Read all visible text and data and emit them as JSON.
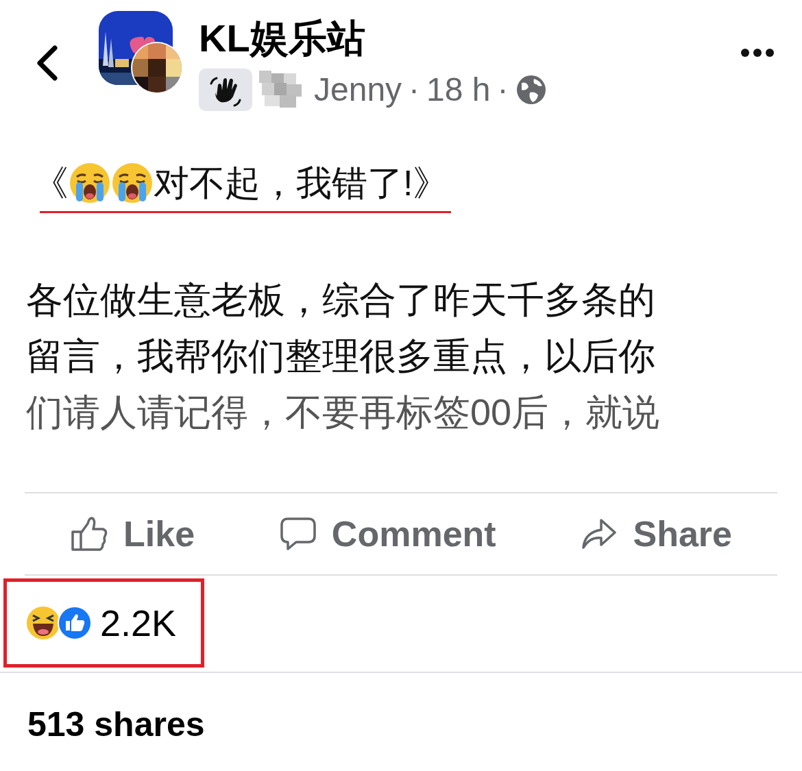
{
  "header": {
    "page_name": "KL娱乐站",
    "author": "Jenny",
    "separator_1": "·",
    "time": "18 h",
    "separator_2": "·"
  },
  "post": {
    "title_open": "《",
    "title_emojis": [
      {
        "kind": "crying"
      },
      {
        "kind": "crying"
      }
    ],
    "title_text": "对不起，我错了!》",
    "body_lines": [
      "各位做生意老板，综合了昨天千多条的",
      "留言，我帮你们整理很多重点，以后你",
      "们请人请记得，不要再标签00后，就说"
    ]
  },
  "actions": [
    {
      "kind": "like",
      "label": "Like"
    },
    {
      "kind": "comment",
      "label": "Comment"
    },
    {
      "kind": "share",
      "label": "Share"
    }
  ],
  "reactions": {
    "count": "2.2K",
    "highlighted": true
  },
  "shares": "513 shares"
}
